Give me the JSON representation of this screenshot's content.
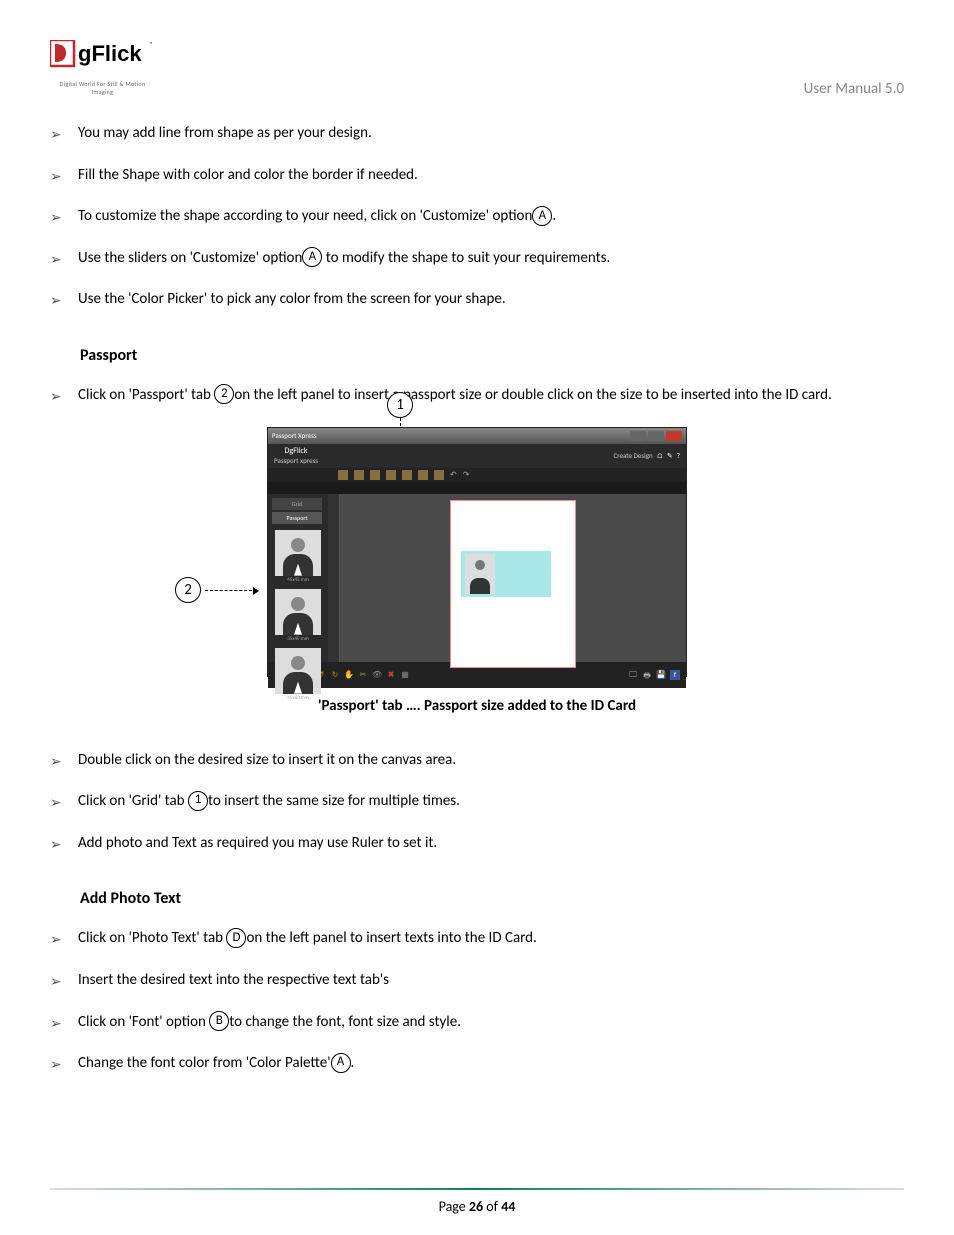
{
  "header": {
    "logo_tagline": "Digital World For Still & Motion Imaging",
    "manual_label": "User Manual 5.0"
  },
  "bullets_top": [
    {
      "text": "You may add line from shape as per your design."
    },
    {
      "pre": "Fill the Shape with color and color the border if needed."
    },
    {
      "pre": "To customize the shape according to your need, click on 'Customize' option",
      "circ": "A",
      "post": "."
    },
    {
      "pre": "Use the sliders on 'Customize' option",
      "circ": "A",
      "post": " to modify the shape to suit your requirements."
    },
    {
      "pre": "Use the 'Color Picker' to pick any color from the screen for your shape."
    }
  ],
  "section_passport": {
    "heading": "Passport",
    "bullet1_pre": "Click on 'Passport' tab ",
    "bullet1_circ": "2",
    "bullet1_post": "on the left panel to insert a passport size or double click on the size to be inserted into the ID card.",
    "caption": "'Passport' tab …. Passport size added to the ID Card"
  },
  "bullets_mid": [
    {
      "pre": "Double click on the desired size to insert it on the canvas area."
    },
    {
      "pre": "Click on 'Grid' tab ",
      "circ": "1",
      "post": "to insert the same size for multiple times."
    },
    {
      "pre": "Add photo and Text as required you may use Ruler to set it."
    }
  ],
  "section_phototext": {
    "heading": "Add Photo Text"
  },
  "bullets_bottom": [
    {
      "pre": "Click on 'Photo Text' tab ",
      "circ": "D",
      "post": "on the left panel to insert texts into the ID Card."
    },
    {
      "pre": "Insert the desired text into the respective text tab's"
    },
    {
      "pre": "Click on 'Font' option ",
      "circ": "B",
      "post": "to change the font, font size and style."
    },
    {
      "pre": "Change the font color from 'Color Palette'",
      "circ": "A",
      "post": "."
    }
  ],
  "annotations": {
    "ann1": "1",
    "ann2": "2"
  },
  "screenshot": {
    "titlebar": "Passport Xpress",
    "app_text": "DgFlick",
    "tab_text": "Passport xpress",
    "header_right": "Create Design",
    "grid_tab": "Grid",
    "passport_tab": "Passport",
    "thumb1": "45x45 mm",
    "thumb2": "35x45 mm",
    "thumb3": "45x60 mm"
  },
  "footer": {
    "page_prefix": "Page ",
    "page_current": "26",
    "page_mid": " of ",
    "page_total": "44"
  }
}
